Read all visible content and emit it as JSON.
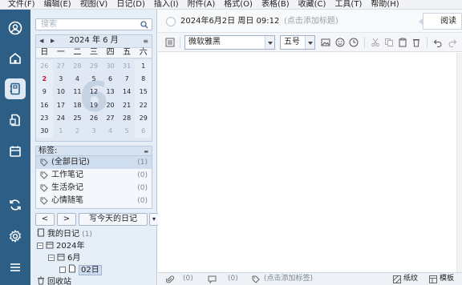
{
  "menu": [
    "文件(F)",
    "编辑(E)",
    "视图(V)",
    "日记(D)",
    "插入(I)",
    "附件(A)",
    "格式(O)",
    "表格(B)",
    "收藏(C)",
    "工具(T)",
    "帮助(H)"
  ],
  "rail": {
    "icons": [
      "account-icon",
      "home-icon",
      "diary-icon",
      "notes-icon",
      "calendar-icon",
      "sync-icon",
      "settings-icon",
      "menu-icon"
    ]
  },
  "search": {
    "placeholder": "搜索"
  },
  "calendar": {
    "prev": "◀",
    "next": "▶",
    "title": "2024 年 6 月",
    "watermark": "6",
    "weekdays": [
      "日",
      "一",
      "二",
      "三",
      "四",
      "五",
      "六"
    ],
    "days": [
      "26",
      "27",
      "28",
      "29",
      "30",
      "31",
      "1",
      "2",
      "3",
      "4",
      "5",
      "6",
      "7",
      "8",
      "9",
      "10",
      "11",
      "12",
      "13",
      "14",
      "15",
      "16",
      "17",
      "18",
      "19",
      "20",
      "21",
      "22",
      "23",
      "24",
      "25",
      "26",
      "27",
      "28",
      "29",
      "30",
      "1",
      "2",
      "3",
      "4",
      "5",
      "6"
    ],
    "today": "2"
  },
  "tags": {
    "header": "标签:",
    "items": [
      {
        "label": "(全部日记)",
        "count": "(1)"
      },
      {
        "label": "工作笔记",
        "count": "(0)"
      },
      {
        "label": "生活杂记",
        "count": "(0)"
      },
      {
        "label": "心情随笔",
        "count": "(0)"
      }
    ]
  },
  "buttons": {
    "prev": "<",
    "next": ">",
    "write_today": "写今天的日记",
    "dropdown": "▾"
  },
  "tree": {
    "root": {
      "label": "我的日记",
      "count": "(1)"
    },
    "year": "2024年",
    "month": "6月",
    "day": "02日",
    "trash": "回收站"
  },
  "header": {
    "date": "2024年6月2日 周日 09:12",
    "title_placeholder": "(点击添加标题)",
    "read_button": "阅读"
  },
  "toolbar": {
    "font": "微软雅黑",
    "size": "五号"
  },
  "status": {
    "attach_count": "(0)",
    "comment_count": "(0)",
    "tag_hint": "(点击添加标签)",
    "paper": "纸纹",
    "template": "模板"
  }
}
